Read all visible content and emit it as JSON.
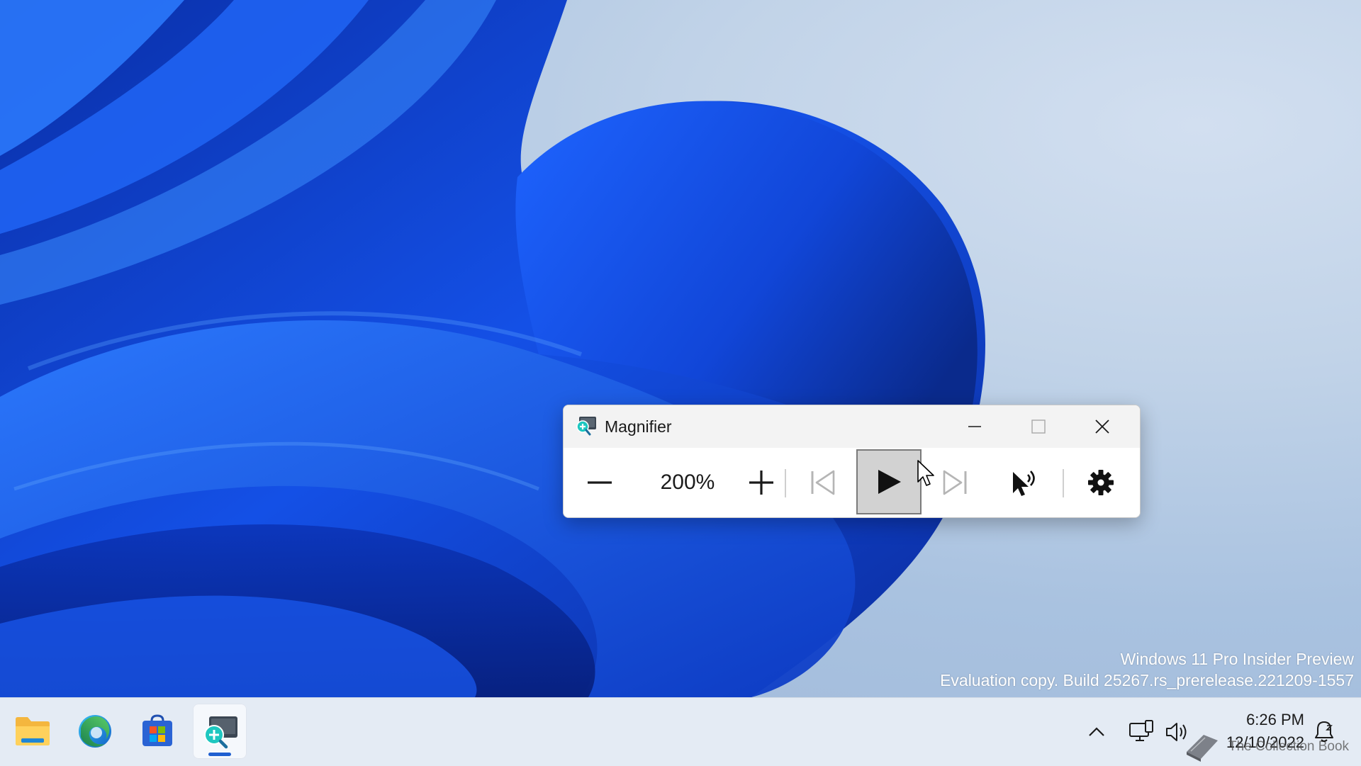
{
  "window": {
    "title": "Magnifier",
    "zoom_level": "200%"
  },
  "watermark": {
    "line1": "Windows 11 Pro Insider Preview",
    "line2": "Evaluation copy. Build 25267.rs_prerelease.221209-1557"
  },
  "taskbar": {
    "apps": [
      "file-explorer",
      "microsoft-edge",
      "microsoft-store",
      "magnifier"
    ],
    "clock_time": "6:26 PM",
    "clock_date": "12/10/2022",
    "overlay_caption": "The Collection Book"
  },
  "colors": {
    "wallpaper_blue": "#1246d6",
    "accent": "#1f5fd0",
    "taskbar_bg": "#e4ebf4"
  }
}
